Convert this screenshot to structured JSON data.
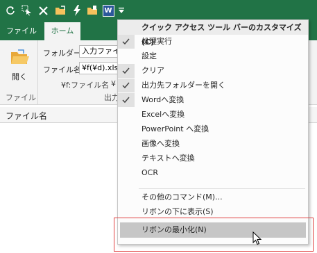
{
  "quick_access": {
    "icons": [
      "refresh-icon",
      "select-cursor-icon",
      "tools-icon",
      "folder-open-icon",
      "flash-icon",
      "folder-convert-icon",
      "word-icon",
      "dropdown-arrow-icon"
    ],
    "word_letter": "W"
  },
  "tabs": [
    {
      "label": "ファイル",
      "active": false
    },
    {
      "label": "ホーム",
      "active": true
    }
  ],
  "ribbon": {
    "open_button_label": "開く",
    "group_file_label": "ファイル",
    "folder_label": "フォルダー",
    "folder_value": "入力ファイル",
    "filename_label": "ファイル名",
    "filename_value": "¥f(¥d).xlsx",
    "format_hint": "¥f:ファイル名",
    "truncated_hint": "¥",
    "output_group_partial": "出力"
  },
  "list_header": {
    "column_filename": "ファイル名"
  },
  "menu": {
    "title": "クイック アクセス ツール バーのカスタマイズ(C)",
    "items": [
      {
        "label": "処理実行",
        "checked": true
      },
      {
        "label": "設定",
        "checked": false
      },
      {
        "label": "クリア",
        "checked": true
      },
      {
        "label": "出力先フォルダーを開く",
        "checked": true
      },
      {
        "label": "Wordへ変換",
        "checked": true
      },
      {
        "label": "Excelへ変換",
        "checked": false
      },
      {
        "label": "PowerPoint へ変換",
        "checked": false
      },
      {
        "label": "画像へ変換",
        "checked": false
      },
      {
        "label": "テキストへ変換",
        "checked": false
      },
      {
        "label": "OCR",
        "checked": false
      }
    ],
    "more_commands": "その他のコマンド(M)...",
    "show_below": "リボンの下に表示(S)",
    "minimize_ribbon": "リボンの最小化(N)"
  },
  "colors": {
    "accent": "#217346",
    "highlight_border": "#e04040",
    "menu_highlight": "#c6c6c6"
  }
}
